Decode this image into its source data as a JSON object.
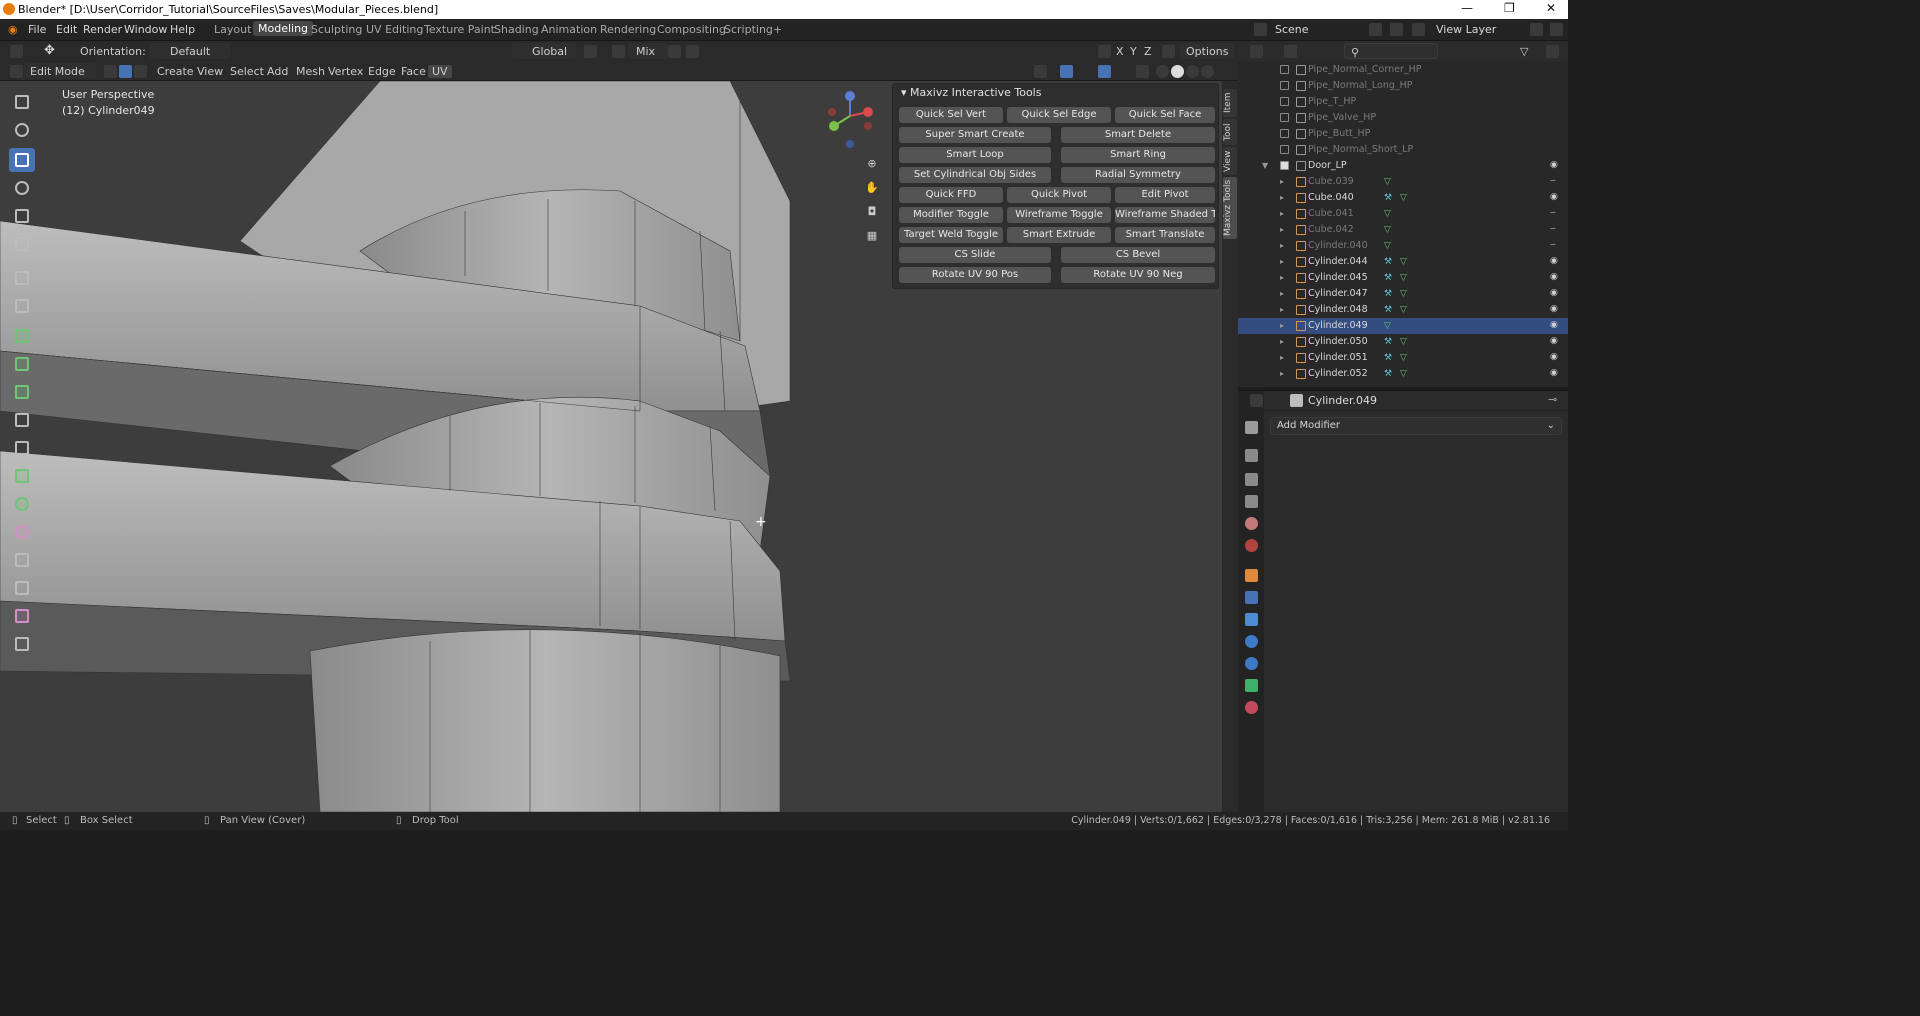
{
  "titlebar": {
    "title": "Blender* [D:\\User\\Corridor_Tutorial\\SourceFiles\\Saves\\Modular_Pieces.blend]"
  },
  "topbar": {
    "menus": [
      "File",
      "Edit",
      "Render",
      "Window",
      "Help"
    ],
    "workspaces": [
      "Layout",
      "Modeling",
      "Sculpting",
      "UV Editing",
      "Texture Paint",
      "Shading",
      "Animation",
      "Rendering",
      "Compositing",
      "Scripting"
    ],
    "active_workspace": "Modeling",
    "add_workspace": "+",
    "scene_label": "Scene",
    "view_layer_label": "View Layer"
  },
  "viewport_header": {
    "orientation_label": "Orientation:",
    "orientation_value": "Default",
    "transform_orientation": "Global",
    "snap_mode": "Mix",
    "axes": [
      "X",
      "Y",
      "Z"
    ],
    "options_label": "Options",
    "mode": "Edit Mode",
    "menus": [
      "Create",
      "View",
      "Select",
      "Add",
      "Mesh",
      "Vertex",
      "Edge",
      "Face",
      "UV"
    ],
    "active_menu": "UV"
  },
  "viewport": {
    "perspective": "User Perspective",
    "object_info": "(12) Cylinder049",
    "gizmo_axes": [
      "Z",
      "Y",
      "X"
    ]
  },
  "maxivz_panel": {
    "title": "Maxivz Interactive Tools",
    "rows": [
      [
        "Quick Sel Vert",
        "Quick Sel Edge",
        "Quick Sel Face"
      ],
      [
        "Super Smart Create",
        "Smart Delete"
      ],
      [
        "Smart Loop",
        "Smart Ring"
      ],
      [
        "Set Cylindrical Obj Sides",
        "Radial Symmetry"
      ],
      [
        "Quick FFD",
        "Quick Pivot",
        "Edit Pivot"
      ],
      [
        "Modifier Toggle",
        "Wireframe Toggle",
        "Wireframe Shaded Tog.."
      ],
      [
        "Target Weld Toggle",
        "Smart Extrude",
        "Smart Translate"
      ],
      [
        "CS Slide",
        "CS Bevel"
      ],
      [
        "Rotate UV 90 Pos",
        "Rotate UV 90 Neg"
      ]
    ]
  },
  "sidebar_tabs": [
    "Item",
    "Tool",
    "View",
    "Maxivz Tools"
  ],
  "outliner": {
    "rows": [
      {
        "name": "Pipe_Normal_Corner_HP",
        "type": "collection",
        "checked": false,
        "dim": true
      },
      {
        "name": "Pipe_Normal_Long_HP",
        "type": "collection",
        "checked": false,
        "dim": true
      },
      {
        "name": "Pipe_T_HP",
        "type": "collection",
        "checked": false,
        "dim": true
      },
      {
        "name": "Pipe_Valve_HP",
        "type": "collection",
        "checked": false,
        "dim": true
      },
      {
        "name": "Pipe_Butt_HP",
        "type": "collection",
        "checked": false,
        "dim": true
      },
      {
        "name": "Pipe_Normal_Short_LP",
        "type": "collection",
        "checked": false,
        "dim": true
      },
      {
        "name": "Door_LP",
        "type": "collection",
        "checked": true,
        "dim": false
      },
      {
        "name": "Cube.039",
        "type": "mesh",
        "dim": true
      },
      {
        "name": "Cube.040",
        "type": "mesh",
        "dim": false
      },
      {
        "name": "Cube.041",
        "type": "mesh",
        "dim": true
      },
      {
        "name": "Cube.042",
        "type": "mesh",
        "dim": true
      },
      {
        "name": "Cylinder.040",
        "type": "mesh",
        "dim": true
      },
      {
        "name": "Cylinder.044",
        "type": "mesh",
        "dim": false
      },
      {
        "name": "Cylinder.045",
        "type": "mesh",
        "dim": false
      },
      {
        "name": "Cylinder.047",
        "type": "mesh",
        "dim": false
      },
      {
        "name": "Cylinder.048",
        "type": "mesh",
        "dim": false
      },
      {
        "name": "Cylinder.049",
        "type": "mesh",
        "dim": false,
        "selected": true
      },
      {
        "name": "Cylinder.050",
        "type": "mesh",
        "dim": false
      },
      {
        "name": "Cylinder.051",
        "type": "mesh",
        "dim": false
      },
      {
        "name": "Cylinder.052",
        "type": "mesh",
        "dim": false
      }
    ]
  },
  "properties": {
    "object_name": "Cylinder.049",
    "add_modifier": "Add Modifier"
  },
  "statusbar": {
    "select": "Select",
    "box_select": "Box Select",
    "pan_view": "Pan View (Cover)",
    "drop_tool": "Drop Tool",
    "stats": "Cylinder.049 | Verts:0/1,662 | Edges:0/3,278 | Faces:0/1,616 | Tris:3,256 | Mem: 261.8 MiB | v2.81.16"
  },
  "colors": {
    "accent": "#4772b3",
    "selected_row": "#334d80",
    "viewport_bg": "#3d3d3d"
  }
}
